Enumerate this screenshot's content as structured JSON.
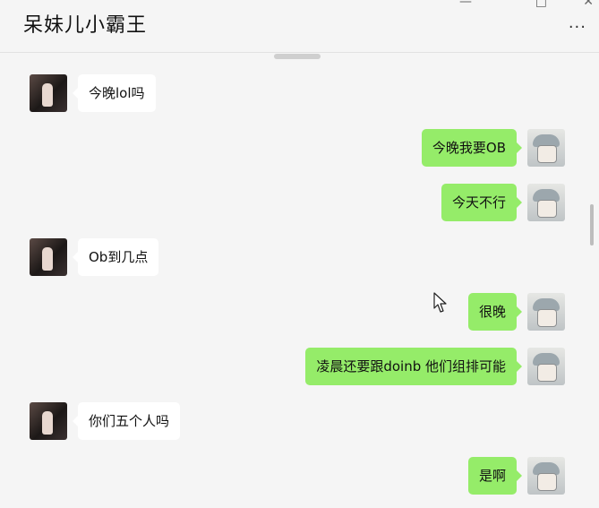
{
  "header": {
    "title": "呆妹儿小霸王",
    "more_icon": "more-icon",
    "window_controls": [
      "minimize-icon",
      "maximize-icon",
      "close-icon"
    ]
  },
  "colors": {
    "sent_bubble": "#95ec69",
    "received_bubble": "#ffffff",
    "background": "#f5f5f5"
  },
  "messages": [
    {
      "side": "left",
      "text": "今晚lol吗"
    },
    {
      "side": "right",
      "text": "今晚我要OB"
    },
    {
      "side": "right",
      "text": "今天不行"
    },
    {
      "side": "left",
      "text": "Ob到几点"
    },
    {
      "side": "right",
      "text": "很晚"
    },
    {
      "side": "right",
      "text": "凌晨还要跟doinb 他们组排可能"
    },
    {
      "side": "left",
      "text": "你们五个人吗"
    },
    {
      "side": "right",
      "text": "是啊"
    }
  ]
}
